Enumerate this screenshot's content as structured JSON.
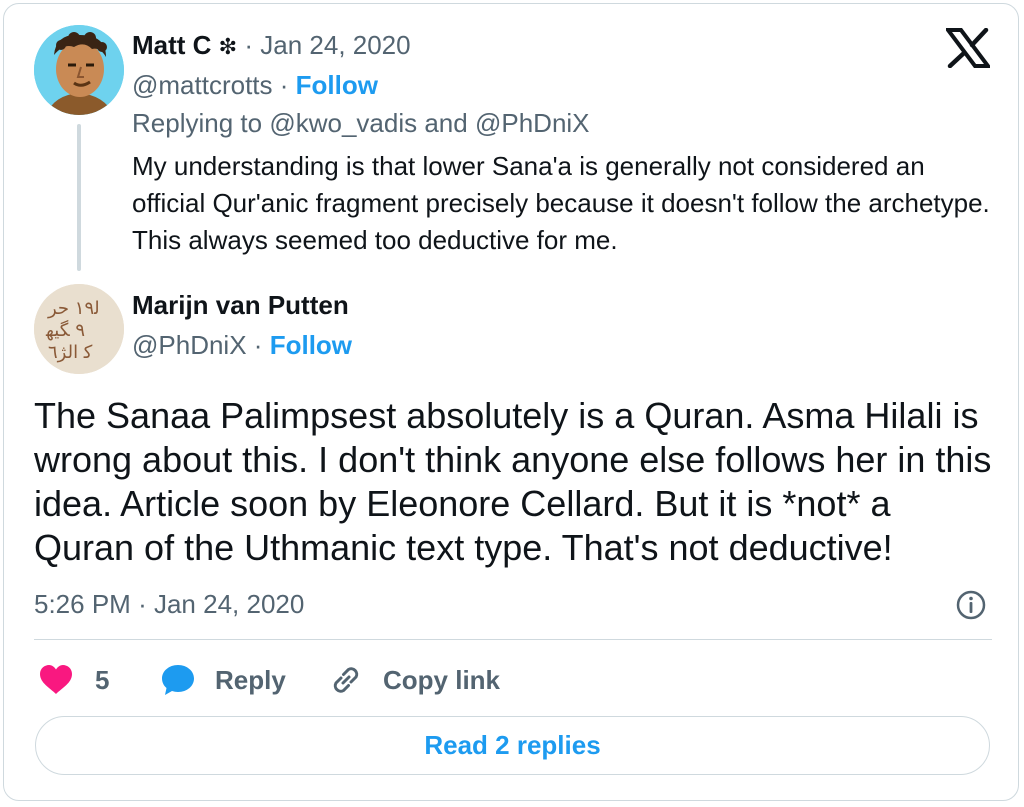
{
  "parent_tweet": {
    "author_name": "Matt C",
    "author_badge": "❇",
    "separator": "·",
    "date": "Jan 24, 2020",
    "handle": "@mattcrotts",
    "follow_label": "Follow",
    "replying_prefix": "Replying to",
    "replying_to_1": "@kwo_vadis",
    "replying_and": "and",
    "replying_to_2": "@PhDniX",
    "text": "My understanding is that lower Sana'a is generally not considered an official Qur'anic fragment precisely because it doesn't follow the archetype. This always seemed too deductive for me."
  },
  "main_tweet": {
    "author_name": "Marijn van Putten",
    "handle": "@PhDniX",
    "separator": "·",
    "follow_label": "Follow",
    "text": "The Sanaa Palimpsest absolutely is a Quran. Asma Hilali is wrong about this. I don't think anyone else follows her in this idea. Article soon by Eleonore Cellard. But it is *not* a Quran of the Uthmanic text type. That's not deductive!",
    "time": "5:26 PM",
    "date": "Jan 24, 2020"
  },
  "actions": {
    "like_count": "5",
    "reply_label": "Reply",
    "copy_link_label": "Copy link"
  },
  "read_replies_label": "Read 2 replies",
  "colors": {
    "accent": "#1d9bf0",
    "like": "#f91880",
    "muted": "#536471",
    "text": "#0f1419",
    "border": "#cfd9de"
  },
  "icons": {
    "platform": "x-logo-icon",
    "like": "heart-icon",
    "reply": "speech-bubble-icon",
    "copy": "link-icon",
    "info": "info-icon"
  }
}
